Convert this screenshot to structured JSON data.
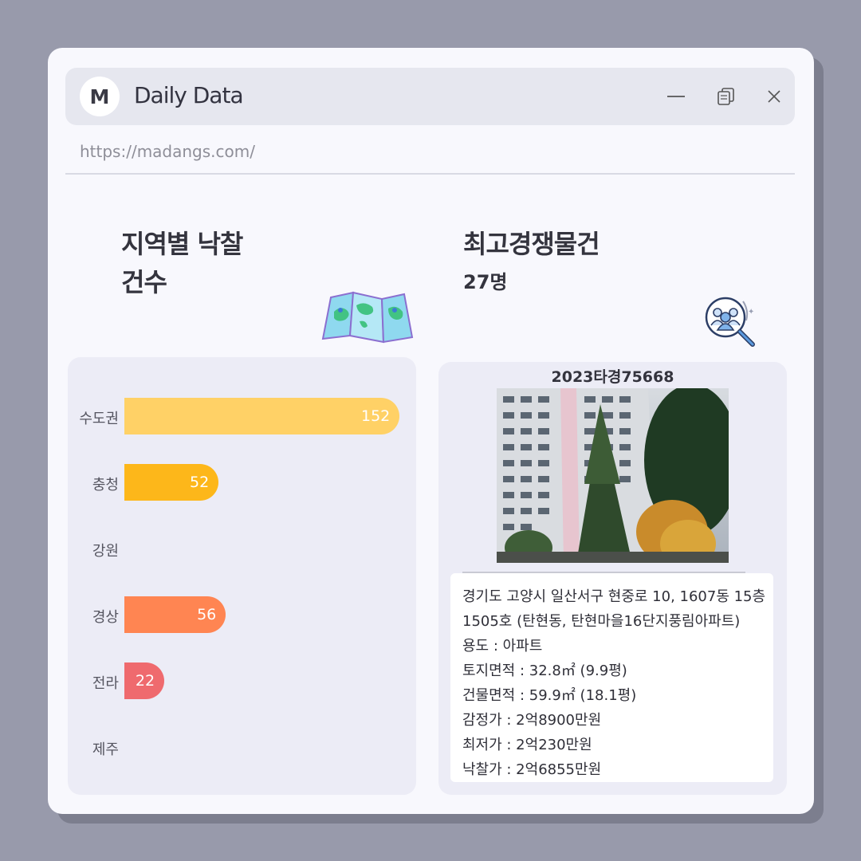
{
  "window": {
    "logo_letter": "M",
    "title": "Daily Data",
    "url": "https://madangs.com/",
    "controls": [
      "minimize-icon",
      "restore-icon",
      "close-icon"
    ]
  },
  "left": {
    "heading_line1": "지역별 낙찰",
    "heading_line2": "건수",
    "icon": "folded-map-icon"
  },
  "right": {
    "heading": "최고경쟁물건",
    "subheading": "27명",
    "icon": "people-search-icon"
  },
  "chart_data": {
    "type": "bar",
    "orientation": "horizontal",
    "categories": [
      "수도권",
      "충청",
      "강원",
      "경상",
      "전라",
      "제주"
    ],
    "values": [
      152,
      52,
      null,
      56,
      22,
      null
    ],
    "value_labels": [
      "152",
      "52",
      "",
      "56",
      "22",
      ""
    ],
    "colors": [
      "#ffd166",
      "#fdb71a",
      "#cccccc",
      "#ff8552",
      "#ef6a6e",
      "#cccccc"
    ],
    "xlim": [
      0,
      152
    ]
  },
  "property": {
    "case_number": "2023타경75668",
    "lines": [
      "경기도 고양시 일산서구 현중로 10, 1607동 15층",
      "1505호 (탄현동, 탄현마을16단지풍림아파트)",
      "용도 : 아파트",
      "토지면적 : 32.8㎡ (9.9평)",
      "건물면적 : 59.9㎡ (18.1평)",
      "감정가 : 2억8900만원",
      "최저가 : 2억230만원",
      "낙찰가 : 2억6855만원"
    ]
  }
}
